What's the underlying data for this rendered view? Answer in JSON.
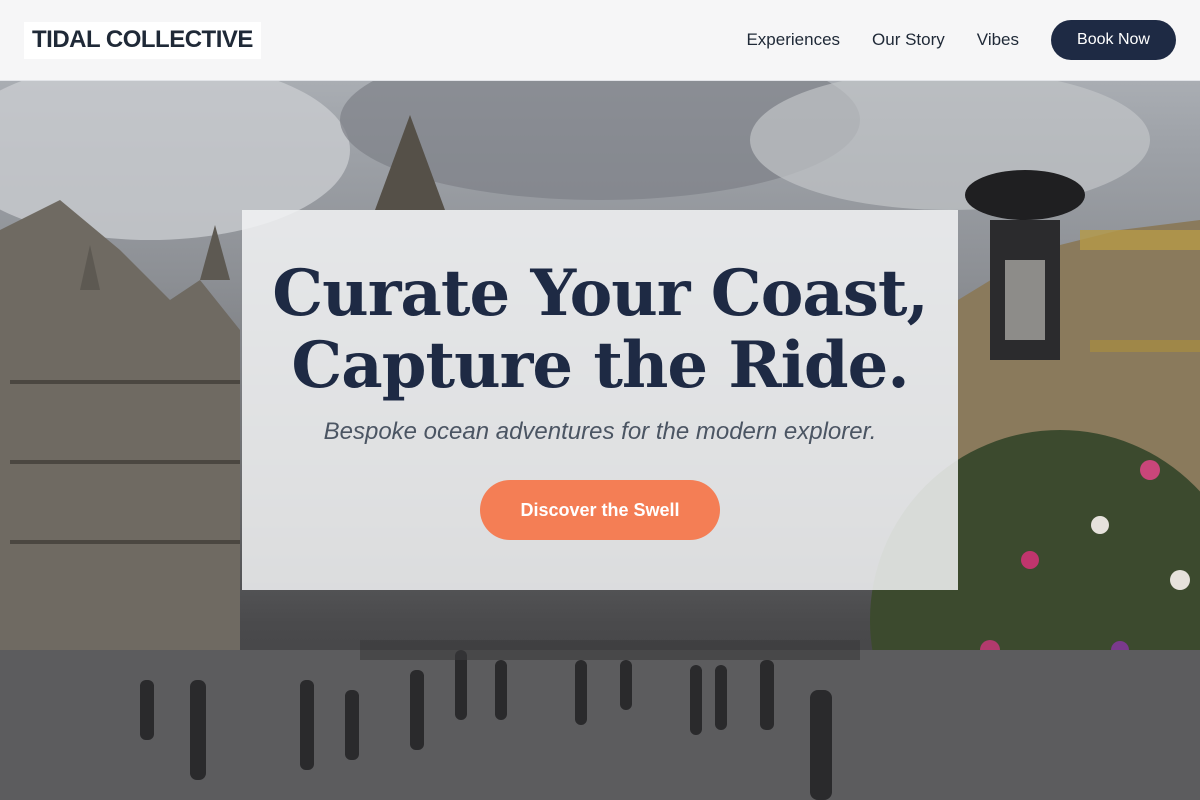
{
  "header": {
    "logo": "TIDAL COLLECTIVE",
    "nav": [
      {
        "label": "Experiences"
      },
      {
        "label": "Our Story"
      },
      {
        "label": "Vibes"
      }
    ],
    "cta_label": "Book Now"
  },
  "hero": {
    "title_line1": "Curate Your Coast,",
    "title_line2": "Capture the Ride.",
    "subtitle": "Bespoke ocean adventures for the modern explorer.",
    "cta_label": "Discover the Swell"
  },
  "colors": {
    "navy": "#1e2a44",
    "accent": "#f47e55",
    "header_bg": "#f6f6f7"
  }
}
